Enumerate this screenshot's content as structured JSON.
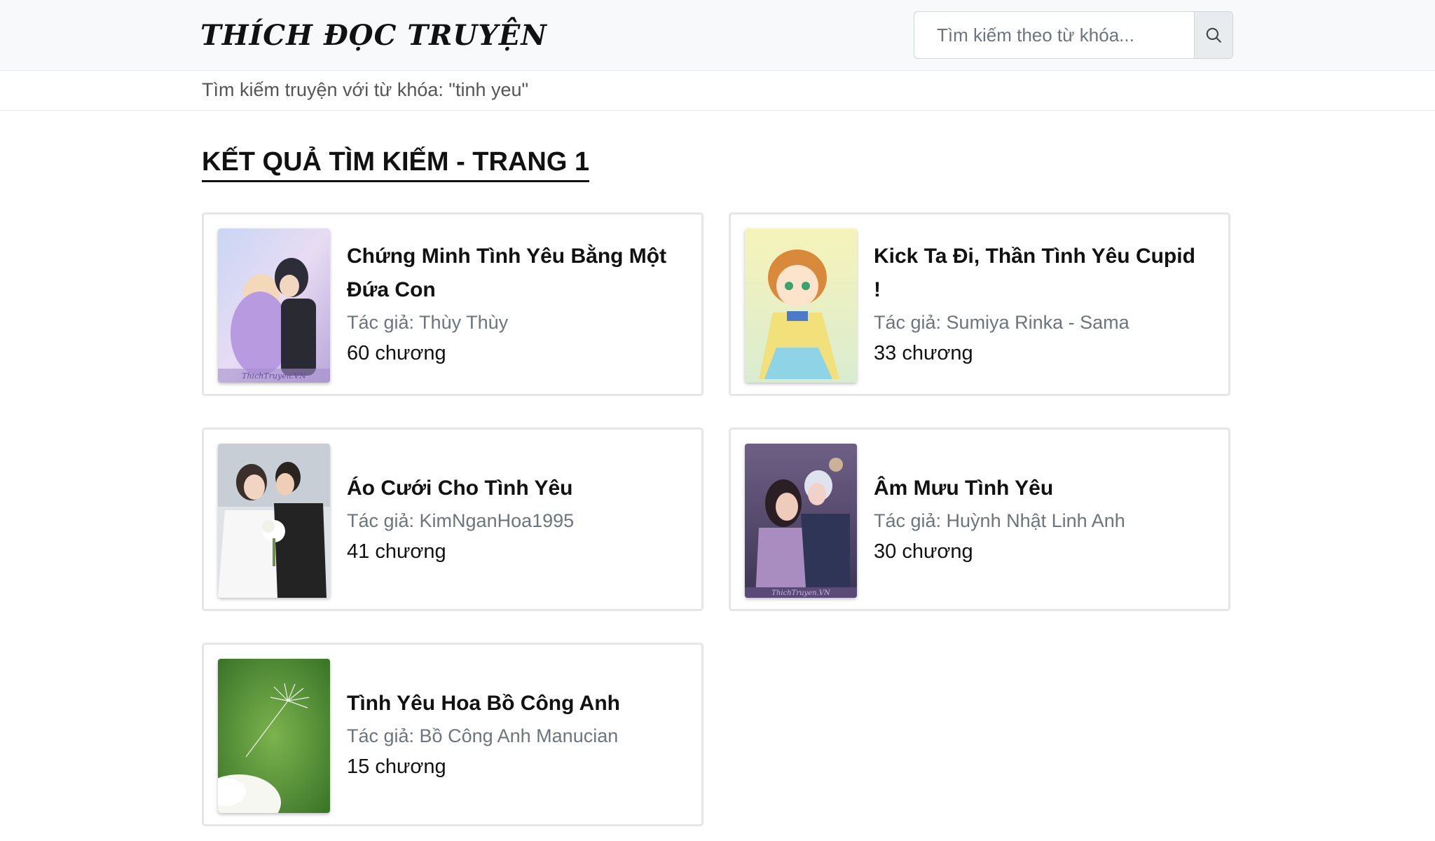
{
  "header": {
    "logo": "THÍCH ĐỌC TRUYỆN",
    "search_placeholder": "Tìm kiếm theo từ khóa...",
    "search_icon": "search-icon"
  },
  "breadcrumb": "Tìm kiếm truyện với từ khóa: \"tinh yeu\"",
  "section_title": "KẾT QUẢ TÌM KIẾM - TRANG 1",
  "results": [
    {
      "title": "Chứng Minh Tình Yêu Bằng Một Đứa Con",
      "author": "Tác giả: Thùy Thùy",
      "chapters": "60 chương",
      "cover_watermark": "ThichTruyen.VN"
    },
    {
      "title": "Kick Ta Đi, Thần Tình Yêu Cupid !",
      "author": "Tác giả: Sumiya Rinka - Sama",
      "chapters": "33 chương"
    },
    {
      "title": "Áo Cưới Cho Tình Yêu",
      "author": "Tác giả: KimNganHoa1995",
      "chapters": "41 chương"
    },
    {
      "title": "Âm Mưu Tình Yêu",
      "author": "Tác giả: Huỳnh Nhật Linh Anh",
      "chapters": "30 chương",
      "cover_watermark": "ThichTruyen.VN"
    },
    {
      "title": "Tình Yêu Hoa Bồ Công Anh",
      "author": "Tác giả: Bồ Công Anh Manucian",
      "chapters": "15 chương"
    }
  ]
}
